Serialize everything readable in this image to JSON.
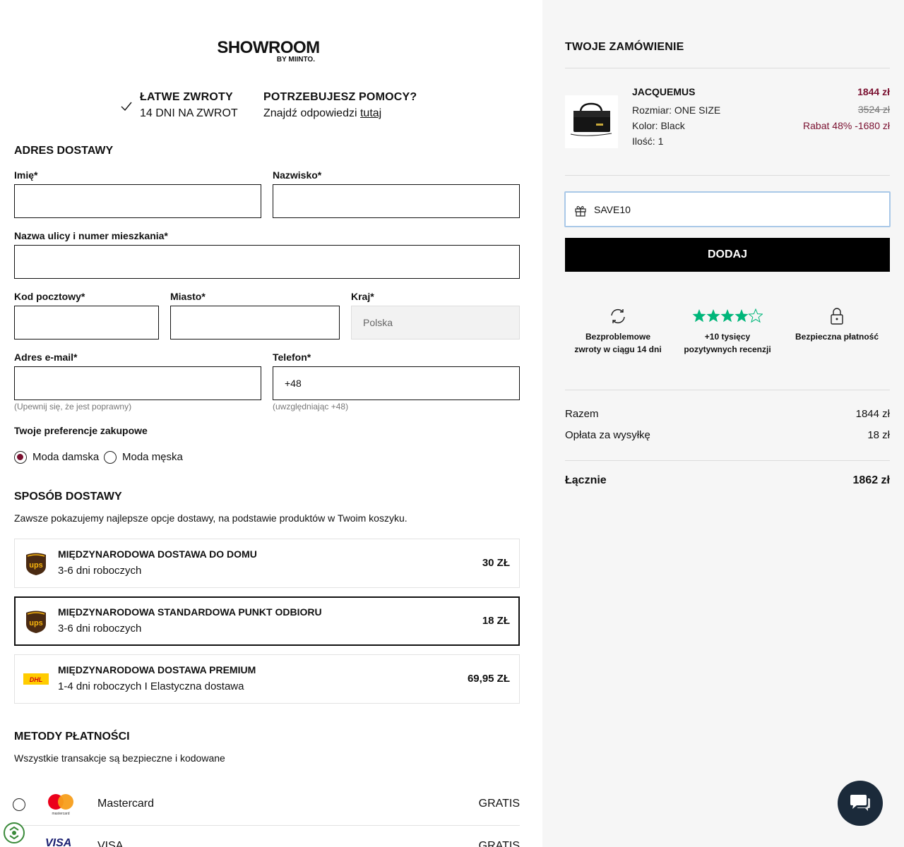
{
  "brand": {
    "logo_main": "SHOWROOM",
    "logo_sub": "BY MIINTO."
  },
  "info": {
    "returns_title": "ŁATWE ZWROTY",
    "returns_sub": "14 DNI NA ZWROT",
    "help_title": "POTRZEBUJESZ POMOCY?",
    "help_sub": "Znajdź odpowiedzi",
    "help_link": "tutaj"
  },
  "address": {
    "title": "ADRES DOSTAWY",
    "first_name_label": "Imię*",
    "last_name_label": "Nazwisko*",
    "street_label": "Nazwa ulicy i numer mieszkania*",
    "postal_label": "Kod pocztowy*",
    "city_label": "Miasto*",
    "country_label": "Kraj*",
    "country_value": "Polska",
    "email_label": "Adres e-mail*",
    "email_hint": "(Upewnij się, że jest poprawny)",
    "phone_label": "Telefon*",
    "phone_value": "+48",
    "phone_hint": "(uwzględniając +48)"
  },
  "preferences": {
    "title": "Twoje preferencje zakupowe",
    "option_women": "Moda damska",
    "option_men": "Moda męska",
    "selected": "Moda damska"
  },
  "shipping": {
    "title": "SPOSÓB DOSTAWY",
    "subtitle": "Zawsze pokazujemy najlepsze opcje dostawy, na podstawie produktów w Twoim koszyku.",
    "options": [
      {
        "carrier": "ups",
        "title": "MIĘDZYNARODOWA DOSTAWA DO DOMU",
        "sub": "3-6 dni roboczych",
        "price": "30 ZŁ"
      },
      {
        "carrier": "ups",
        "title": "MIĘDZYNARODOWA STANDARDOWA PUNKT ODBIORU",
        "sub": "3-6 dni roboczych",
        "price": "18 ZŁ"
      },
      {
        "carrier": "dhl",
        "title": "MIĘDZYNARODOWA DOSTAWA PREMIUM",
        "sub": "1-4 dni roboczych I Elastyczna dostawa",
        "price": "69,95 ZŁ"
      }
    ],
    "selected_index": 1
  },
  "payment": {
    "title": "METODY PŁATNOŚCI",
    "subtitle": "Wszystkie transakcje są bezpieczne i kodowane",
    "methods": [
      {
        "name": "Mastercard",
        "price": "GRATIS",
        "logo_text": "mastercard"
      },
      {
        "name": "VISA",
        "price": "GRATIS",
        "logo_text": "VISA"
      }
    ]
  },
  "order": {
    "title": "TWOJE ZAMÓWIENIE",
    "product": {
      "brand": "JACQUEMUS",
      "size": "Rozmiar: ONE SIZE",
      "color": "Kolor: Black",
      "qty": "Ilość: 1",
      "price": "1844 zł",
      "old_price": "3524 zł",
      "discount": "Rabat 48% -1680 zł"
    },
    "promo_value": "SAVE10",
    "add_button": "DODAJ",
    "features": [
      {
        "icon": "refresh-icon",
        "text1": "Bezproblemowe",
        "text2": "zwroty w ciągu 14 dni"
      },
      {
        "icon": "stars-icon",
        "text1": "+10 tysięcy",
        "text2": "pozytywnych recenzji"
      },
      {
        "icon": "lock-icon",
        "text1": "Bezpieczna płatność",
        "text2": ""
      }
    ],
    "rating_stars": 4,
    "summary": {
      "subtotal_label": "Razem",
      "subtotal": "1844 zł",
      "shipping_label": "Opłata za wysyłkę",
      "shipping": "18 zł",
      "total_label": "Łącznie",
      "total": "1862 zł"
    }
  },
  "colors": {
    "accent": "#7a1030",
    "panel": "#f6f6f6",
    "ups_brown": "#4a2a12",
    "ups_gold": "#f6b40e",
    "dhl_yellow": "#ffcc00",
    "dhl_red": "#d40511",
    "star_green": "#00b67a"
  }
}
